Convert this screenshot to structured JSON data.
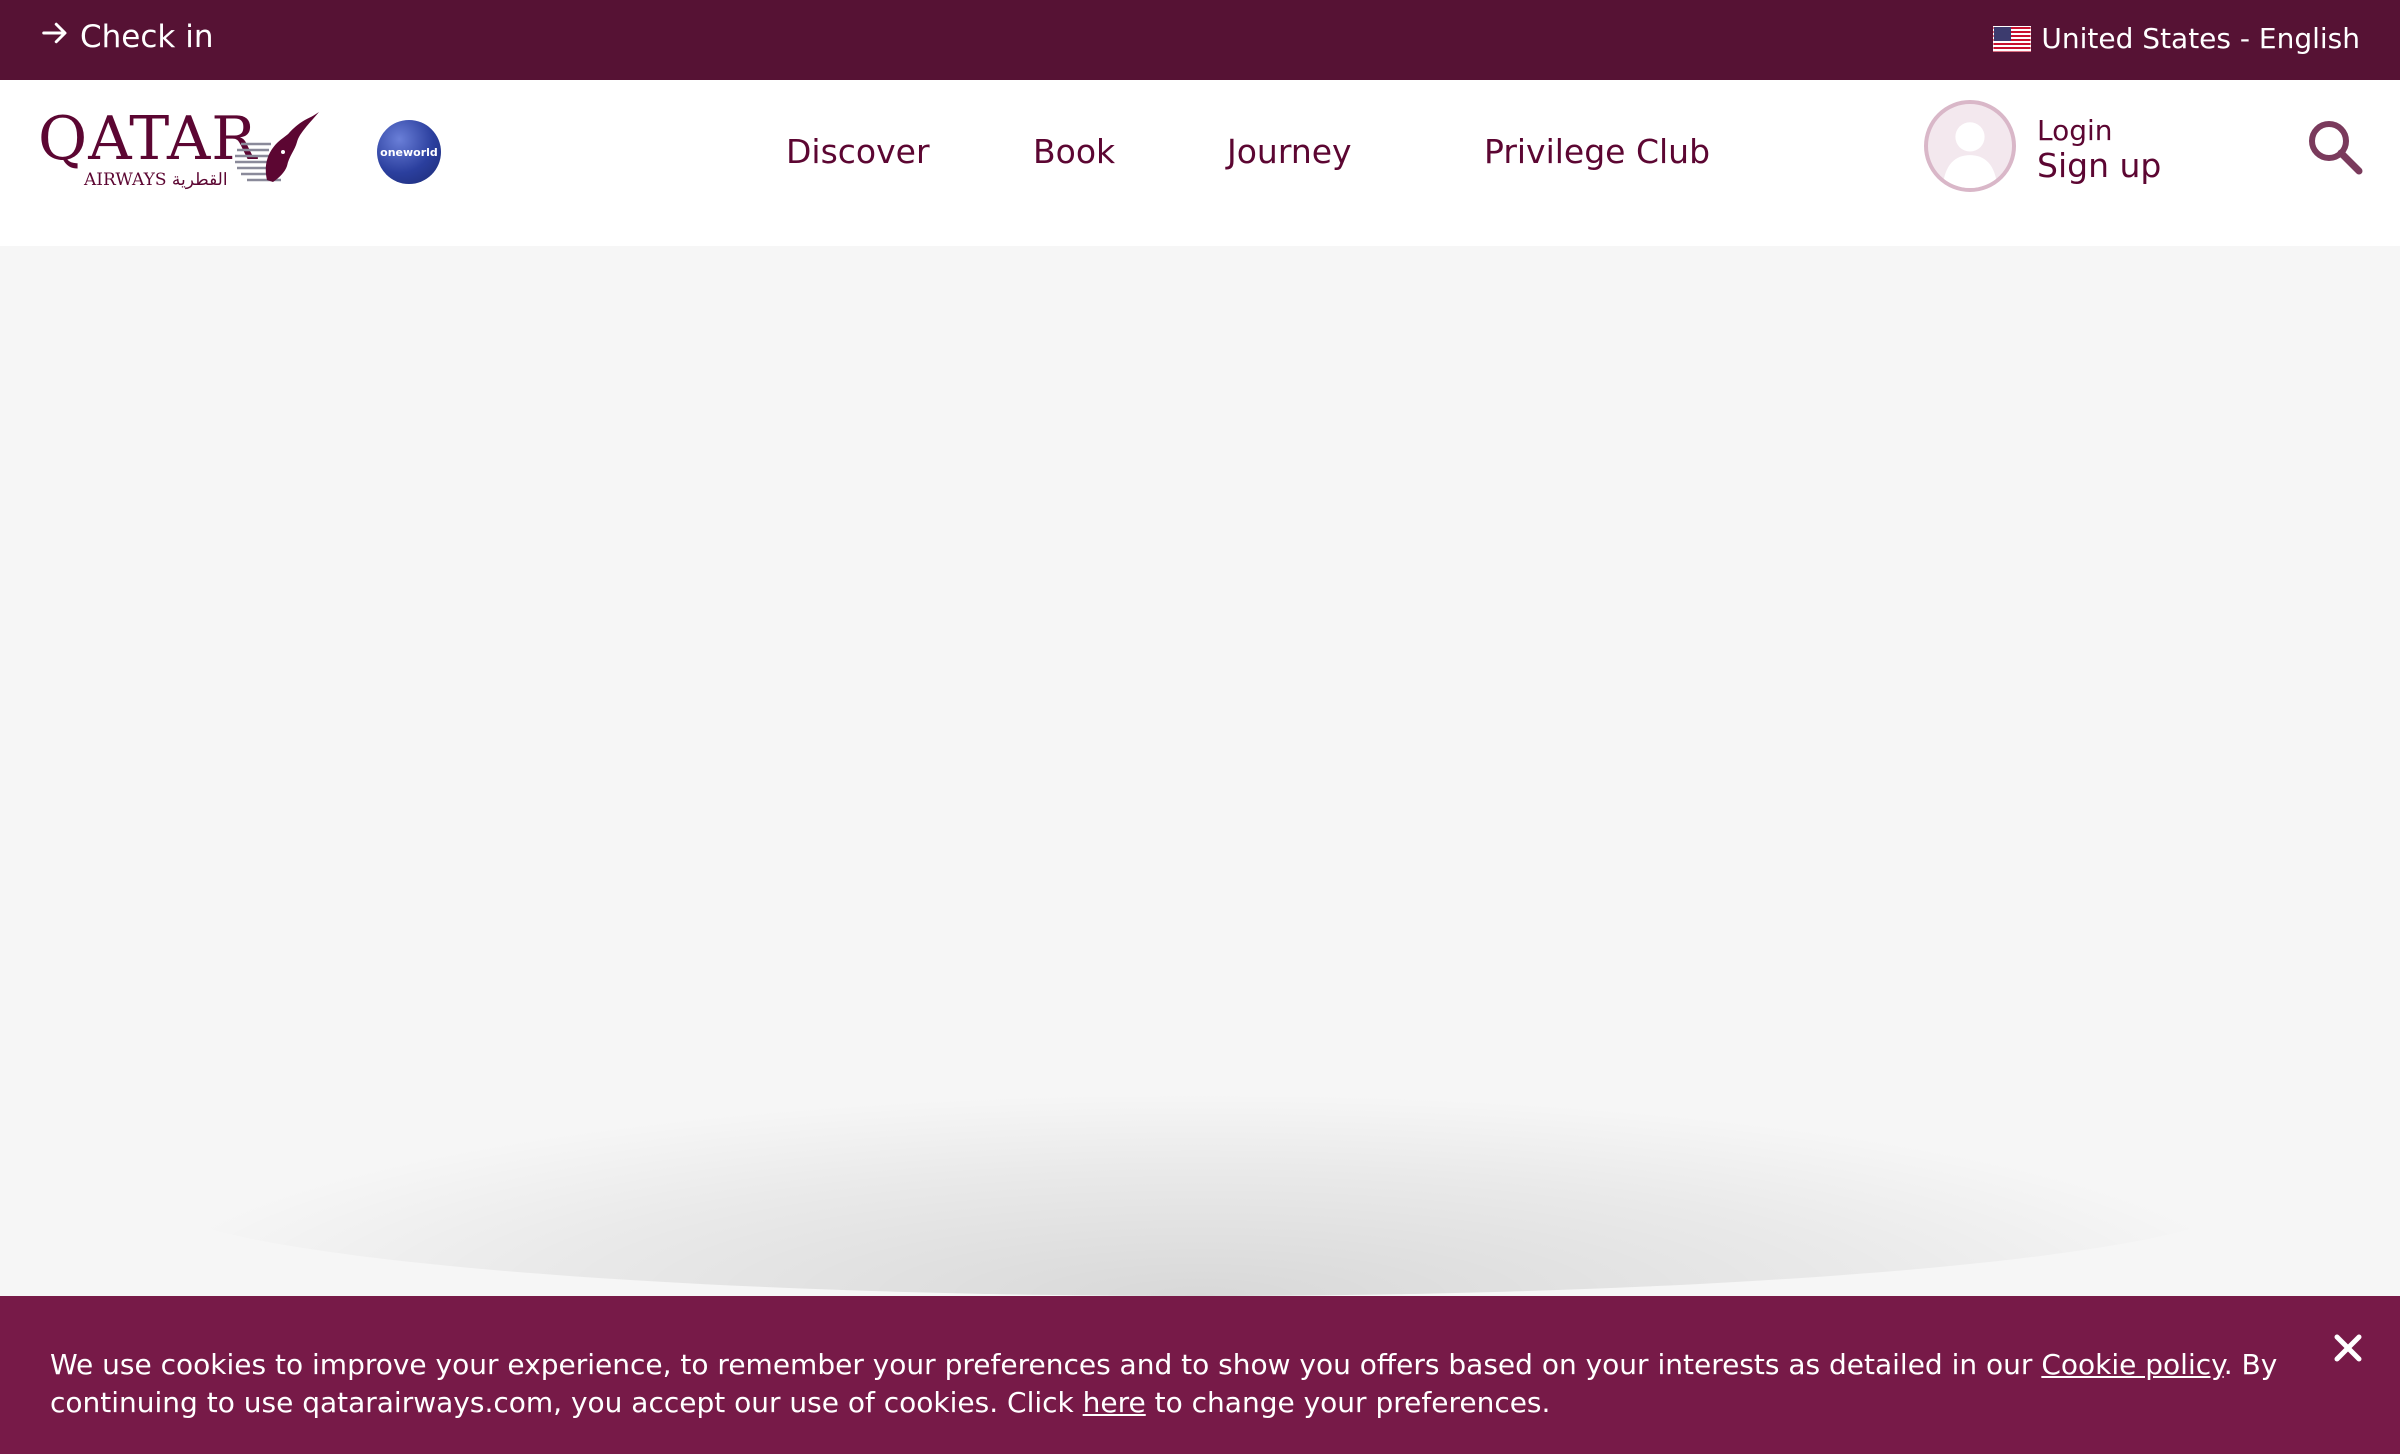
{
  "topbar": {
    "checkin_label": "Check in",
    "locale_label": "United States - English"
  },
  "header": {
    "logo_text": "QATAR",
    "logo_sub": "AIRWAYS القطرية",
    "alliance_badge": "oneworld",
    "nav": [
      {
        "label": "Discover"
      },
      {
        "label": "Book"
      },
      {
        "label": "Journey"
      },
      {
        "label": "Privilege Club"
      }
    ],
    "login_label": "Login",
    "signup_label": "Sign up"
  },
  "cookie_banner": {
    "text_part1": "We use cookies to improve your experience, to remember your preferences and to show you offers based on your interests as detailed in our ",
    "policy_link": "Cookie policy",
    "text_part2": ". By continuing to use qatarairways.com, you accept our use of cookies. Click ",
    "here_link": "here",
    "text_part3": " to change your preferences."
  },
  "icons": {
    "checkin": "arrow-right-icon",
    "flag": "us-flag-icon",
    "avatar": "user-avatar-icon",
    "search": "search-icon",
    "close": "close-icon"
  },
  "colors": {
    "topbar_bg": "#561234",
    "brand": "#5c0632",
    "cookie_bg": "#771a48",
    "page_bg": "#f6f6f6"
  }
}
